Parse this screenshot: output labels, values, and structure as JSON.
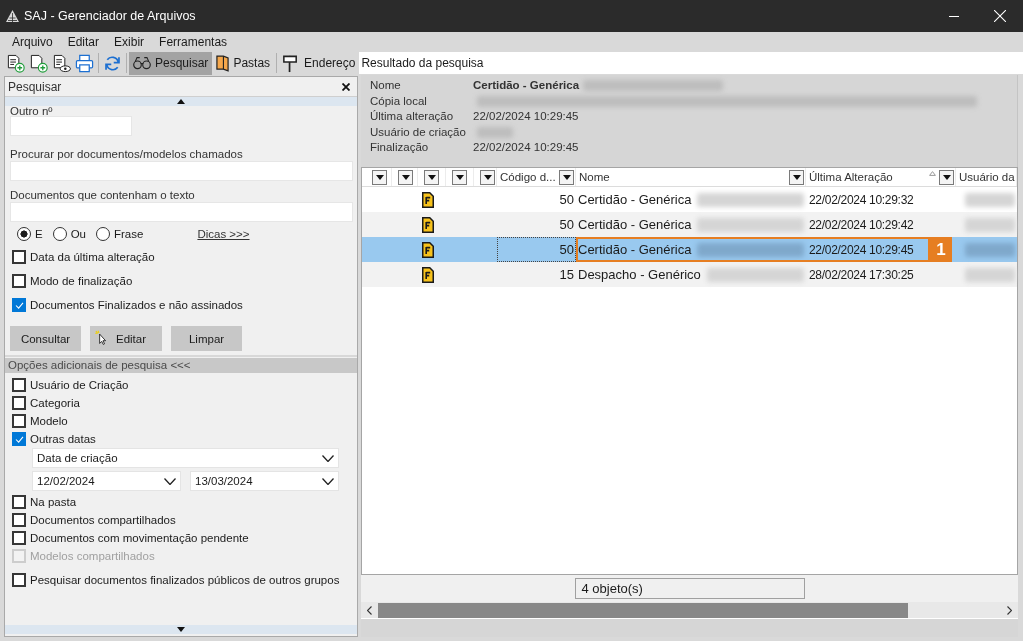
{
  "window": {
    "title": "SAJ - Gerenciador de Arquivos"
  },
  "menu": [
    {
      "label": "Arquivo"
    },
    {
      "label": "Editar"
    },
    {
      "label": "Exibir"
    },
    {
      "label": "Ferramentas"
    }
  ],
  "toolbar": {
    "toggles": [
      {
        "label": "Pesquisar",
        "selected": true
      },
      {
        "label": "Pastas",
        "selected": false
      }
    ],
    "address_label": "Endereço",
    "address": "Resultado da pesquisa"
  },
  "search_panel": {
    "title": "Pesquisar",
    "fields": [
      {
        "kind": "short",
        "label": "Outro nº"
      },
      {
        "kind": "wide",
        "label": "Procurar por documentos/modelos chamados"
      },
      {
        "kind": "wide",
        "label": "Documentos que contenham o texto"
      }
    ],
    "match_modes": [
      {
        "label": "E",
        "selected": true
      },
      {
        "label": "Ou",
        "selected": false
      },
      {
        "label": "Frase",
        "selected": false
      }
    ],
    "tips_link": "Dicas >>>",
    "filters": [
      {
        "label": "Data da última alteração",
        "checked": false
      },
      {
        "label": "Modo de finalização",
        "checked": false
      },
      {
        "label": "Documentos Finalizados e não assinados",
        "checked": true
      }
    ],
    "buttons": [
      {
        "label": "Consultar",
        "pointer": false
      },
      {
        "label": "Editar",
        "pointer": true
      },
      {
        "label": "Limpar",
        "pointer": false
      }
    ]
  },
  "extra_options": {
    "title": "Opções adicionais de pesquisa <<<",
    "items": [
      {
        "kind": "checkbox",
        "label": "Usuário de Criação",
        "checked": false,
        "disabled": false
      },
      {
        "kind": "checkbox",
        "label": "Categoria",
        "checked": false,
        "disabled": false
      },
      {
        "kind": "checkbox",
        "label": "Modelo",
        "checked": false,
        "disabled": false
      },
      {
        "kind": "checkbox",
        "label": "Outras datas",
        "checked": true,
        "disabled": false
      },
      {
        "kind": "select",
        "value": "Data de criação"
      },
      {
        "kind": "range",
        "from": "12/02/2024",
        "to": "13/03/2024"
      },
      {
        "kind": "checkbox",
        "label": "Na pasta",
        "checked": false,
        "disabled": false
      },
      {
        "kind": "checkbox",
        "label": "Documentos compartilhados",
        "checked": false,
        "disabled": false
      },
      {
        "kind": "checkbox",
        "label": "Documentos com movimentação pendente",
        "checked": false,
        "disabled": false
      },
      {
        "kind": "checkbox",
        "label": "Modelos compartilhados",
        "checked": false,
        "disabled": true
      },
      {
        "kind": "checkbox",
        "label": "Pesquisar documentos finalizados públicos de outros grupos",
        "checked": false,
        "disabled": false
      }
    ]
  },
  "details": [
    {
      "label": "Nome",
      "value": "Certidão - Genérica",
      "redacted": true
    },
    {
      "label": "Cópia local",
      "redacted": true
    },
    {
      "label": "Última alteração",
      "value": "22/02/2024 10:29:45",
      "redacted": false
    },
    {
      "label": "Usuário de criação",
      "redacted": true
    },
    {
      "label": "Finalização",
      "value": "22/02/2024 10:29:45",
      "redacted": false
    }
  ],
  "table": {
    "columns": [
      {
        "kind": "filter",
        "menu_button": true,
        "sorted": false
      },
      {
        "kind": "filter",
        "menu_button": true,
        "sorted": false
      },
      {
        "kind": "filter",
        "menu_button": true,
        "sorted": false
      },
      {
        "kind": "filter",
        "menu_button": true,
        "sorted": false
      },
      {
        "kind": "filter",
        "menu_button": true,
        "sorted": false
      },
      {
        "kind": "text",
        "label": "Código d...",
        "menu_button": true,
        "sorted": false
      },
      {
        "kind": "text",
        "label": "Nome",
        "menu_button": true,
        "sorted": false
      },
      {
        "kind": "text",
        "label": "Última Alteração",
        "menu_button": true,
        "sorted": true
      },
      {
        "kind": "text",
        "label": "Usuário da",
        "menu_button": false,
        "sorted": false
      }
    ],
    "rows": [
      {
        "code": "50",
        "name": "Certidão - Genérica",
        "modified": "22/02/2024 10:29:32",
        "redacted": true,
        "selected": false
      },
      {
        "code": "50",
        "name": "Certidão - Genérica",
        "modified": "22/02/2024 10:29:42",
        "redacted": true,
        "selected": false
      },
      {
        "code": "50",
        "name": "Certidão - Genérica",
        "modified": "22/02/2024 10:29:45",
        "redacted": true,
        "selected": true,
        "callout": "1"
      },
      {
        "code": "15",
        "name": "Despacho - Genérico",
        "modified": "28/02/2024 17:30:25",
        "redacted": true,
        "selected": false
      }
    ]
  },
  "status": "4 objeto(s)"
}
